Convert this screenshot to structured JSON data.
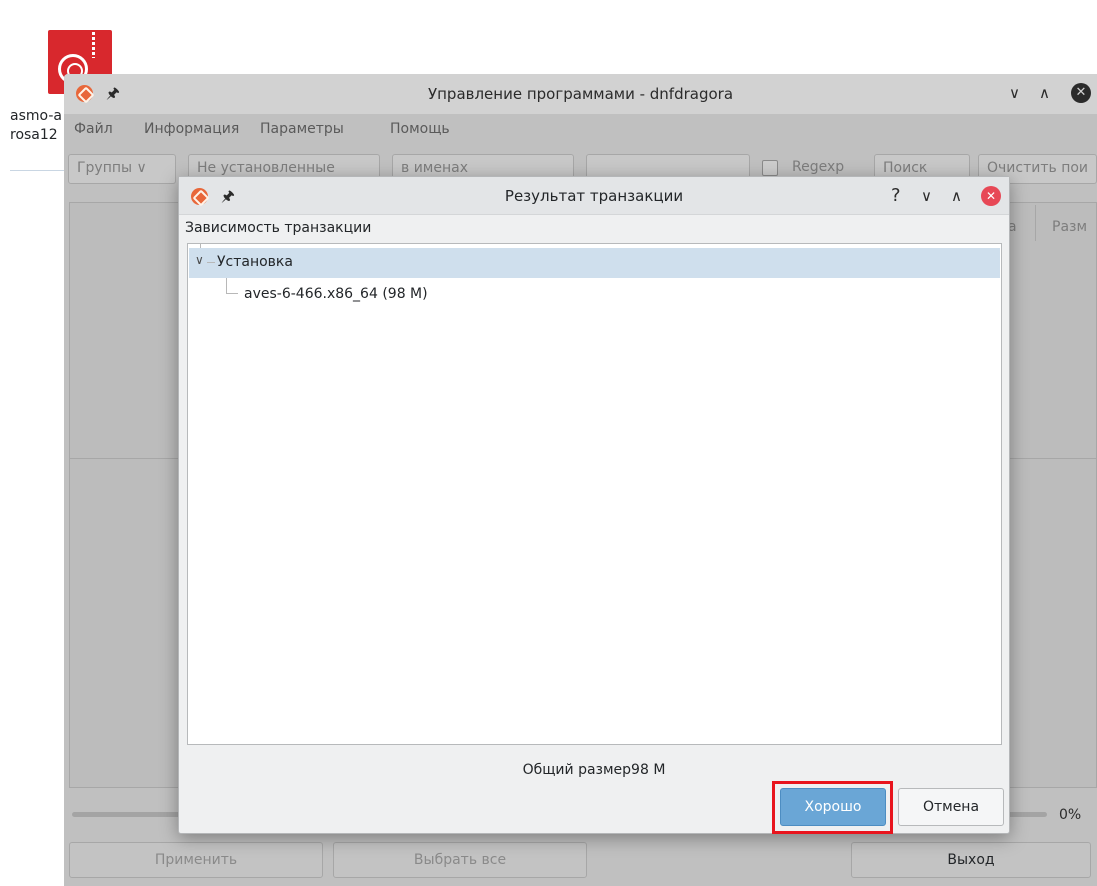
{
  "desktop": {
    "icon_label_line1": "asmo-a",
    "icon_label_line2": "rosa12",
    "icon_name": "archive-file-icon",
    "accent": "#d8282d"
  },
  "main_window": {
    "title": "Управление программами - dnfdragora",
    "menu": [
      "Файл",
      "Информация",
      "Параметры",
      "Помощь"
    ],
    "filters": {
      "groups": "Группы",
      "install_state": "Не установленные",
      "search_in": "в именах",
      "search_value": "",
      "regexp_label": "Regexp",
      "search_button": "Поиск",
      "clear_button": "Очистить пои"
    },
    "table_headers_partial": [
      "а",
      "Разм"
    ],
    "progress_text": "0%",
    "progress": 0,
    "buttons": {
      "apply": "Применить",
      "select_all": "Выбрать все",
      "exit": "Выход"
    }
  },
  "dialog": {
    "title": "Результат транзакции",
    "help_glyph": "?",
    "section_label": "Зависимость транзакции",
    "tree": {
      "group": "Установка",
      "items": [
        "aves-6-466.x86_64 (98 M)"
      ]
    },
    "total": "Общий размер98 M",
    "ok_label": "Хорошо",
    "cancel_label": "Отмена",
    "accent": "#6aa6d6",
    "highlight": "#e8141d"
  }
}
